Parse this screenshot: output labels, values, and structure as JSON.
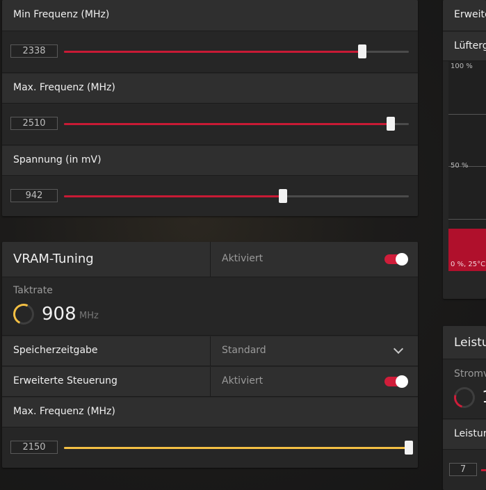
{
  "gpu_tuning": {
    "min_freq": {
      "label": "Min Frequenz (MHz)",
      "value": "2338",
      "fraction": 0.864
    },
    "max_freq": {
      "label": "Max. Frequenz (MHz)",
      "value": "2510",
      "fraction": 0.947
    },
    "voltage": {
      "label": "Spannung (in mV)",
      "value": "942",
      "fraction": 0.636
    }
  },
  "vram": {
    "title": "VRAM-Tuning",
    "enabled_label": "Aktiviert",
    "clock_label": "Taktrate",
    "clock_value": "908",
    "clock_unit": "MHz",
    "timing_label": "Speicherzeitgabe",
    "timing_value": "Standard",
    "advanced_label": "Erweiterte Steuerung",
    "advanced_value": "Aktiviert",
    "max_freq": {
      "label": "Max. Frequenz (MHz)",
      "value": "2150",
      "fraction": 1.0
    }
  },
  "right_panel": {
    "erweitert": "Erweite",
    "luefter": "Lüfterg",
    "y100": "100 %",
    "y50": "50 %",
    "point": "0 %, 25°C",
    "leistung_title": "Leistu",
    "strom": "Stromv",
    "strom_value": "1",
    "leistung_row": "Leistur",
    "power_value": "7"
  },
  "colors": {
    "accent_red": "#d01d3a",
    "accent_yellow": "#f4c044"
  }
}
